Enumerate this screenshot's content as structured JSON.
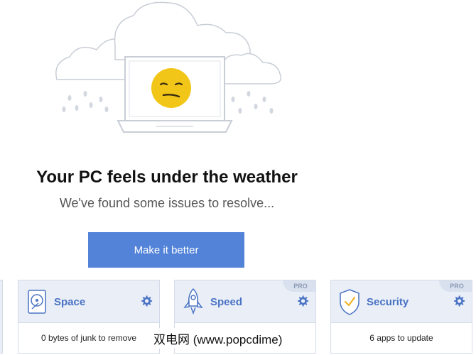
{
  "hero": {
    "title": "Your PC feels under the weather",
    "subtitle": "We've found some issues to resolve...",
    "cta_label": "Make it better"
  },
  "cards": [
    {
      "label": "Space",
      "status": "0 bytes of junk to remove",
      "icon": "disk-icon",
      "pro": false
    },
    {
      "label": "Speed",
      "status": "",
      "icon": "rocket-icon",
      "pro": true,
      "pro_label": "PRO"
    },
    {
      "label": "Security",
      "status": "6 apps to update",
      "icon": "shield-icon",
      "pro": true,
      "pro_label": "PRO"
    }
  ],
  "watermark": "双电网 (www.popcdime)",
  "colors": {
    "accent": "#5283d9",
    "card_header": "#e9eef7",
    "card_border": "#d4dbe8",
    "label": "#4a73c4",
    "emoji": "#f2c618"
  }
}
